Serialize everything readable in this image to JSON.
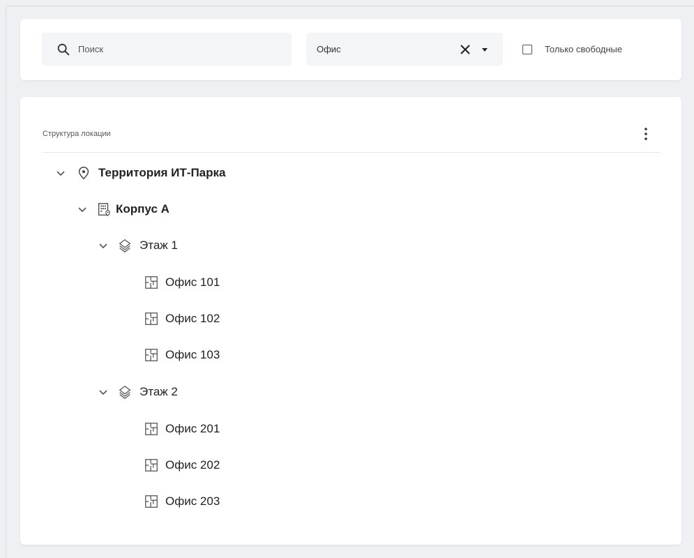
{
  "filters": {
    "search": {
      "placeholder": "Поиск",
      "icon": "search-icon"
    },
    "type_select": {
      "value": "Офис",
      "clear_icon": "close-icon",
      "caret_icon": "caret-down-icon"
    },
    "only_free": {
      "label": "Только свободные",
      "checked": false
    }
  },
  "tree": {
    "title": "Структура локации",
    "menu_icon": "more-vert-icon",
    "nodes": {
      "territory": "Территория ИТ-Парка",
      "building": "Корпус А",
      "floor1": "Этаж 1",
      "office101": "Офис 101",
      "office102": "Офис 102",
      "office103": "Офис 103",
      "floor2": "Этаж 2",
      "office201": "Офис 201",
      "office202": "Офис 202",
      "office203": "Офис 203"
    }
  },
  "colors": {
    "background": "#eef0f3",
    "card": "#ffffff",
    "field": "#f4f5f7",
    "text": "#222222",
    "icon": "#555555"
  }
}
